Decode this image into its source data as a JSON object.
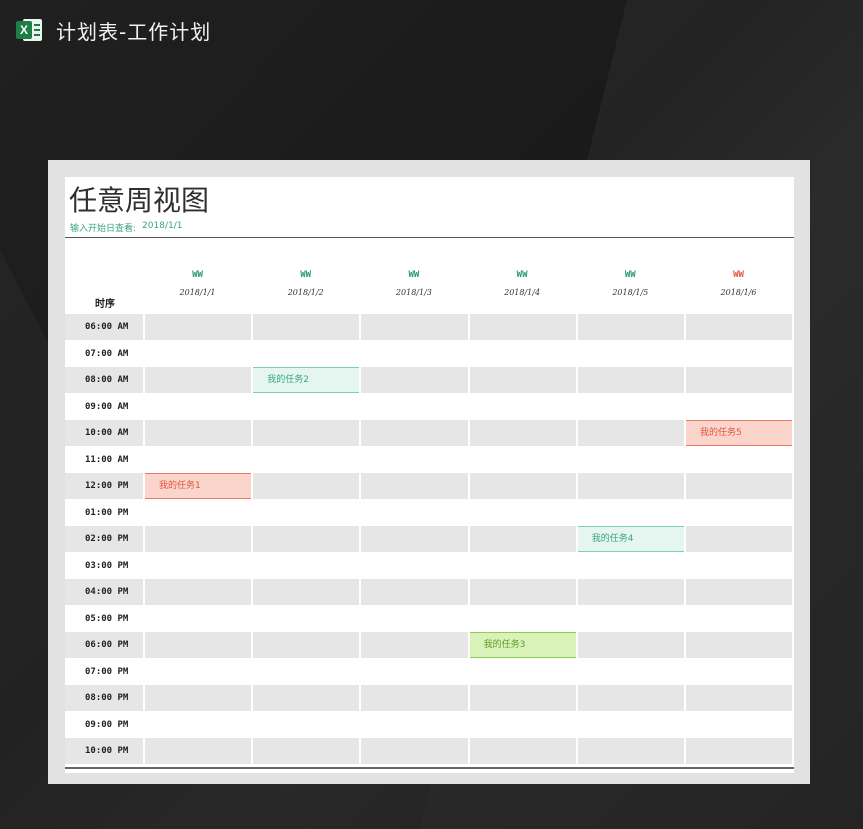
{
  "app": {
    "title": "计划表-工作计划",
    "icon": "excel-icon",
    "accent": "#1e7e45"
  },
  "sheet": {
    "title": "任意周视图",
    "start_label": "输入开始日查看:",
    "start_date": "2018/1/1"
  },
  "schedule": {
    "time_header": "时序",
    "days": [
      {
        "weekday": "WW",
        "date": "2018/1/1",
        "weekend": false
      },
      {
        "weekday": "WW",
        "date": "2018/1/2",
        "weekend": false
      },
      {
        "weekday": "WW",
        "date": "2018/1/3",
        "weekend": false
      },
      {
        "weekday": "WW",
        "date": "2018/1/4",
        "weekend": false
      },
      {
        "weekday": "WW",
        "date": "2018/1/5",
        "weekend": false
      },
      {
        "weekday": "WW",
        "date": "2018/1/6",
        "weekend": true
      }
    ],
    "times": [
      "06:00 AM",
      "07:00 AM",
      "08:00 AM",
      "09:00 AM",
      "10:00 AM",
      "11:00 AM",
      "12:00 PM",
      "01:00 PM",
      "02:00 PM",
      "03:00 PM",
      "04:00 PM",
      "05:00 PM",
      "06:00 PM",
      "07:00 PM",
      "08:00 PM",
      "09:00 PM",
      "10:00 PM"
    ],
    "tasks": [
      {
        "label": "我的任务1",
        "time_index": 6,
        "day_index": 0,
        "style": "pink"
      },
      {
        "label": "我的任务2",
        "time_index": 2,
        "day_index": 1,
        "style": "mint"
      },
      {
        "label": "我的任务3",
        "time_index": 12,
        "day_index": 3,
        "style": "lime"
      },
      {
        "label": "我的任务4",
        "time_index": 8,
        "day_index": 4,
        "style": "mint"
      },
      {
        "label": "我的任务5",
        "time_index": 4,
        "day_index": 5,
        "style": "pink"
      }
    ]
  },
  "colors": {
    "teal": "#3aa57e",
    "red": "#e5563e",
    "shade": "#e6e6e6"
  }
}
